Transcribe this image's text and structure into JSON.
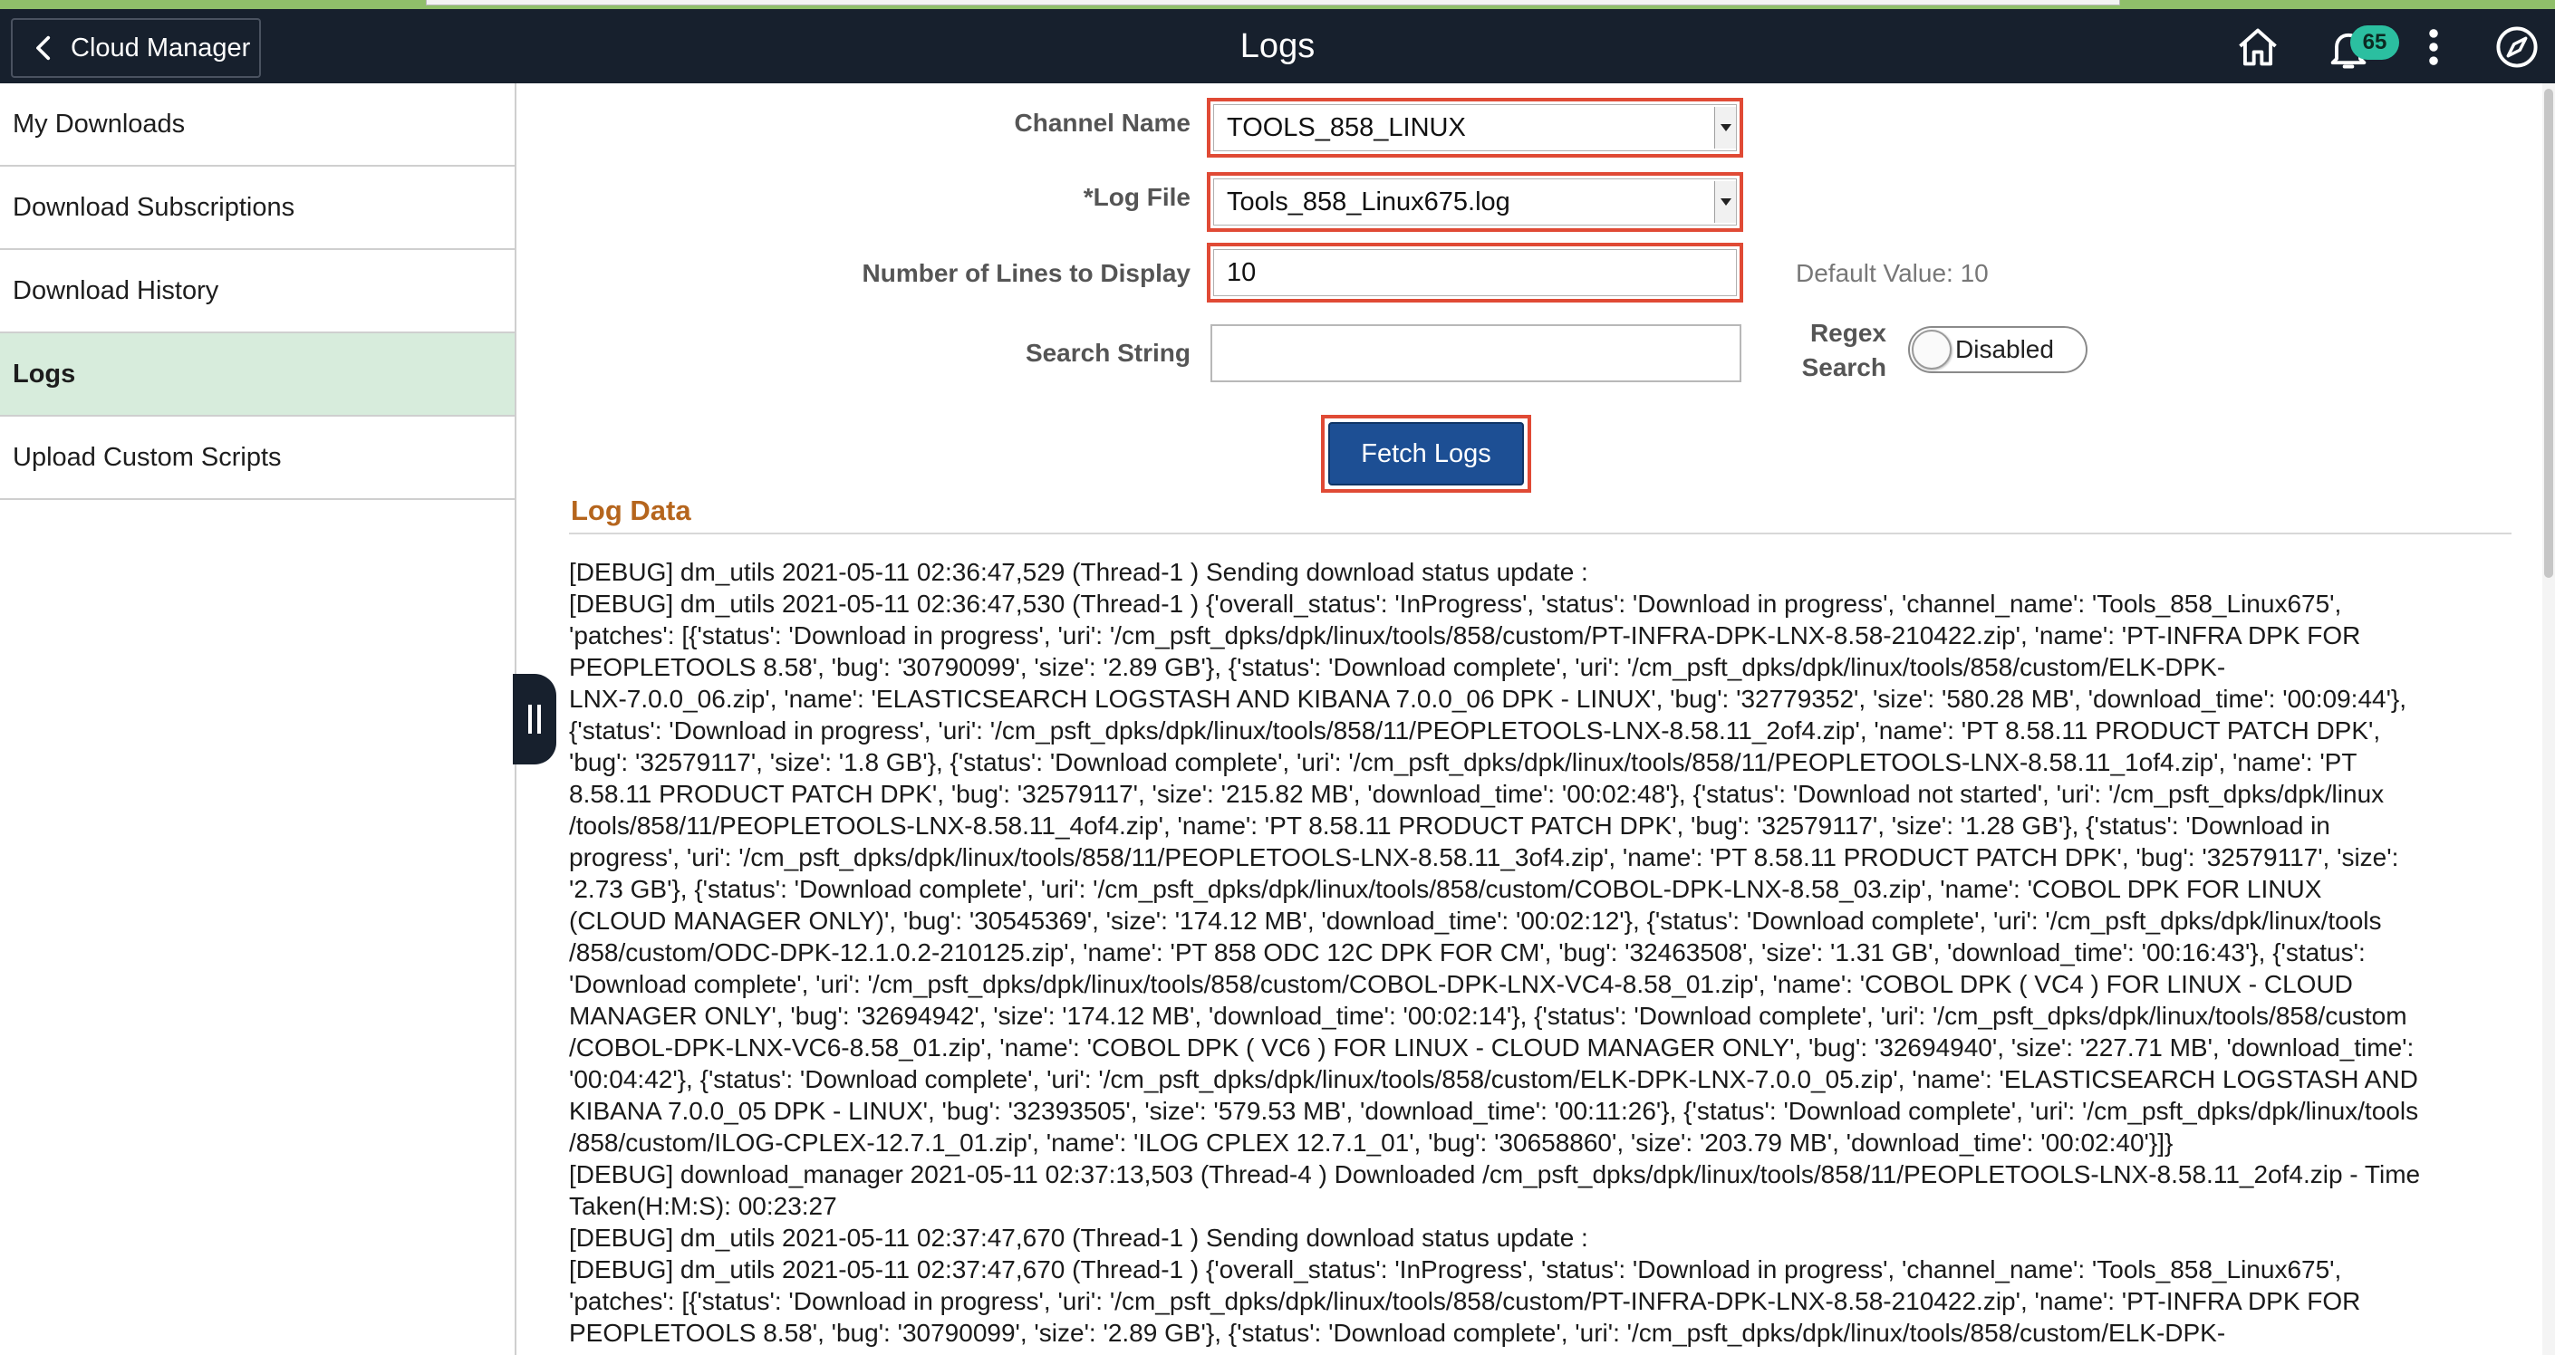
{
  "header": {
    "back_label": "Cloud Manager",
    "title": "Logs",
    "notification_count": "65",
    "icons": [
      "home-icon",
      "bell-icon",
      "more-vertical-icon",
      "compass-icon"
    ]
  },
  "sidebar": {
    "items": [
      {
        "label": "My Downloads"
      },
      {
        "label": "Download Subscriptions"
      },
      {
        "label": "Download History"
      },
      {
        "label": "Logs",
        "active": true
      },
      {
        "label": "Upload Custom Scripts"
      }
    ]
  },
  "form": {
    "channel_label": "Channel Name",
    "channel_value": "TOOLS_858_LINUX",
    "logfile_label": "*Log File",
    "logfile_value": "Tools_858_Linux675.log",
    "lines_label": "Number of Lines to Display",
    "lines_value": "10",
    "lines_hint": "Default Value: 10",
    "search_label": "Search String",
    "search_value": "",
    "regex_label_1": "Regex",
    "regex_label_2": "Search",
    "regex_state": "Disabled",
    "fetch_label": "Fetch Logs"
  },
  "log": {
    "section_title": "Log Data",
    "lines": [
      "[DEBUG] dm_utils 2021-05-11 02:36:47,529 (Thread-1 ) Sending download status update :",
      "[DEBUG] dm_utils 2021-05-11 02:36:47,530 (Thread-1 ) {'overall_status': 'InProgress', 'status': 'Download in progress', 'channel_name': 'Tools_858_Linux675',",
      "'patches': [{'status': 'Download in progress', 'uri': '/cm_psft_dpks/dpk/linux/tools/858/custom/PT-INFRA-DPK-LNX-8.58-210422.zip', 'name': 'PT-INFRA DPK FOR",
      "PEOPLETOOLS 8.58', 'bug': '30790099', 'size': '2.89 GB'}, {'status': 'Download complete', 'uri': '/cm_psft_dpks/dpk/linux/tools/858/custom/ELK-DPK-",
      "LNX-7.0.0_06.zip', 'name': 'ELASTICSEARCH LOGSTASH AND KIBANA 7.0.0_06 DPK - LINUX', 'bug': '32779352', 'size': '580.28 MB', 'download_time': '00:09:44'},",
      "{'status': 'Download in progress', 'uri': '/cm_psft_dpks/dpk/linux/tools/858/11/PEOPLETOOLS-LNX-8.58.11_2of4.zip', 'name': 'PT 8.58.11 PRODUCT PATCH DPK',",
      "'bug': '32579117', 'size': '1.8 GB'}, {'status': 'Download complete', 'uri': '/cm_psft_dpks/dpk/linux/tools/858/11/PEOPLETOOLS-LNX-8.58.11_1of4.zip', 'name': 'PT",
      "8.58.11 PRODUCT PATCH DPK', 'bug': '32579117', 'size': '215.82 MB', 'download_time': '00:02:48'}, {'status': 'Download not started', 'uri': '/cm_psft_dpks/dpk/linux",
      "/tools/858/11/PEOPLETOOLS-LNX-8.58.11_4of4.zip', 'name': 'PT 8.58.11 PRODUCT PATCH DPK', 'bug': '32579117', 'size': '1.28 GB'}, {'status': 'Download in",
      "progress', 'uri': '/cm_psft_dpks/dpk/linux/tools/858/11/PEOPLETOOLS-LNX-8.58.11_3of4.zip', 'name': 'PT 8.58.11 PRODUCT PATCH DPK', 'bug': '32579117', 'size':",
      "'2.73 GB'}, {'status': 'Download complete', 'uri': '/cm_psft_dpks/dpk/linux/tools/858/custom/COBOL-DPK-LNX-8.58_03.zip', 'name': 'COBOL DPK FOR LINUX",
      "(CLOUD MANAGER ONLY)', 'bug': '30545369', 'size': '174.12 MB', 'download_time': '00:02:12'}, {'status': 'Download complete', 'uri': '/cm_psft_dpks/dpk/linux/tools",
      "/858/custom/ODC-DPK-12.1.0.2-210125.zip', 'name': 'PT 858 ODC 12C DPK FOR CM', 'bug': '32463508', 'size': '1.31 GB', 'download_time': '00:16:43'}, {'status':",
      "'Download complete', 'uri': '/cm_psft_dpks/dpk/linux/tools/858/custom/COBOL-DPK-LNX-VC4-8.58_01.zip', 'name': 'COBOL DPK ( VC4 ) FOR LINUX - CLOUD",
      "MANAGER ONLY', 'bug': '32694942', 'size': '174.12 MB', 'download_time': '00:02:14'}, {'status': 'Download complete', 'uri': '/cm_psft_dpks/dpk/linux/tools/858/custom",
      "/COBOL-DPK-LNX-VC6-8.58_01.zip', 'name': 'COBOL DPK ( VC6 ) FOR LINUX - CLOUD MANAGER ONLY', 'bug': '32694940', 'size': '227.71 MB', 'download_time':",
      "'00:04:42'}, {'status': 'Download complete', 'uri': '/cm_psft_dpks/dpk/linux/tools/858/custom/ELK-DPK-LNX-7.0.0_05.zip', 'name': 'ELASTICSEARCH LOGSTASH AND",
      "KIBANA 7.0.0_05 DPK - LINUX', 'bug': '32393505', 'size': '579.53 MB', 'download_time': '00:11:26'}, {'status': 'Download complete', 'uri': '/cm_psft_dpks/dpk/linux/tools",
      "/858/custom/ILOG-CPLEX-12.7.1_01.zip', 'name': 'ILOG CPLEX 12.7.1_01', 'bug': '30658860', 'size': '203.79 MB', 'download_time': '00:02:40'}]}",
      "[DEBUG] download_manager 2021-05-11 02:37:13,503 (Thread-4 ) Downloaded /cm_psft_dpks/dpk/linux/tools/858/11/PEOPLETOOLS-LNX-8.58.11_2of4.zip - Time",
      "Taken(H:M:S): 00:23:27",
      "[DEBUG] dm_utils 2021-05-11 02:37:47,670 (Thread-1 ) Sending download status update :",
      "[DEBUG] dm_utils 2021-05-11 02:37:47,670 (Thread-1 ) {'overall_status': 'InProgress', 'status': 'Download in progress', 'channel_name': 'Tools_858_Linux675',",
      "'patches': [{'status': 'Download in progress', 'uri': '/cm_psft_dpks/dpk/linux/tools/858/custom/PT-INFRA-DPK-LNX-8.58-210422.zip', 'name': 'PT-INFRA DPK FOR",
      "PEOPLETOOLS 8.58', 'bug': '30790099', 'size': '2.89 GB'}, {'status': 'Download complete', 'uri': '/cm_psft_dpks/dpk/linux/tools/858/custom/ELK-DPK-"
    ]
  },
  "colors": {
    "header_bg": "#17202d",
    "active_item_bg": "#d7ecdc",
    "highlight_border": "#e04a35",
    "button_bg": "#1d4f94",
    "section_title": "#b5651d",
    "badge_bg": "#2bbfa0"
  }
}
